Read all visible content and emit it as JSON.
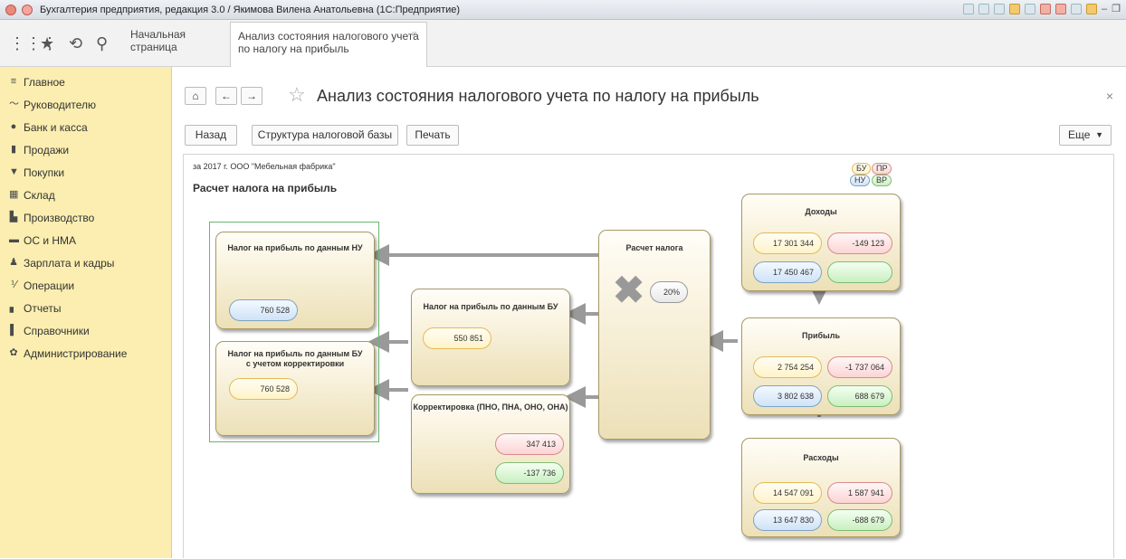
{
  "window": {
    "title": "Бухгалтерия предприятия, редакция 3.0 / Якимова Вилена Анатольевна (1С:Предприятие)"
  },
  "toolbar": {
    "home_tab": "Начальная страница",
    "active_tab": "Анализ состояния налогового учета по налогу на прибыль",
    "close": "×"
  },
  "sidebar": {
    "items": [
      {
        "label": "Главное",
        "icon": "menu-icon"
      },
      {
        "label": "Руководителю",
        "icon": "chart-line-icon"
      },
      {
        "label": "Банк и касса",
        "icon": "coins-icon"
      },
      {
        "label": "Продажи",
        "icon": "bag-icon"
      },
      {
        "label": "Покупки",
        "icon": "cart-icon"
      },
      {
        "label": "Склад",
        "icon": "warehouse-icon"
      },
      {
        "label": "Производство",
        "icon": "factory-icon"
      },
      {
        "label": "ОС и НМА",
        "icon": "truck-icon"
      },
      {
        "label": "Зарплата и кадры",
        "icon": "person-icon"
      },
      {
        "label": "Операции",
        "icon": "operations-icon"
      },
      {
        "label": "Отчеты",
        "icon": "bar-chart-icon"
      },
      {
        "label": "Справочники",
        "icon": "book-icon"
      },
      {
        "label": "Администрирование",
        "icon": "gear-icon"
      }
    ]
  },
  "page": {
    "title": "Анализ состояния налогового учета по налогу на прибыль",
    "close": "×"
  },
  "buttons": {
    "back": "Назад",
    "structure": "Структура налоговой базы",
    "print": "Печать",
    "more": "Еще"
  },
  "report": {
    "period": "за 2017 г. ООО \"Мебельная фабрика\"",
    "subtitle": "Расчет налога на прибыль",
    "legend": {
      "bu": "БУ",
      "pr": "ПР",
      "nu": "НУ",
      "vr": "ВР"
    },
    "tax_nu": {
      "title": "Налог на прибыль по данным НУ",
      "value": "760 528"
    },
    "tax_bu_adj": {
      "title": "Налог на прибыль по данным БУ с учетом корректировки",
      "value": "760 528"
    },
    "tax_bu": {
      "title": "Налог на прибыль по данным БУ",
      "value": "550 851"
    },
    "correction": {
      "title": "Корректировка (ПНО, ПНА, ОНО, ОНА)",
      "value1": "347 413",
      "value2": "-137 736"
    },
    "calc": {
      "title": "Расчет налога",
      "rate": "20%"
    },
    "income": {
      "title": "Доходы",
      "bu": "17 301 344",
      "pr": "-149 123",
      "nu": "17 450 467",
      "vr": ""
    },
    "profit": {
      "title": "Прибыль",
      "bu": "2 754 254",
      "pr": "-1 737 064",
      "nu": "3 802 638",
      "vr": "688 679"
    },
    "expenses": {
      "title": "Расходы",
      "bu": "14 547 091",
      "pr": "1 587 941",
      "nu": "13 647 830",
      "vr": "-688 679"
    }
  }
}
